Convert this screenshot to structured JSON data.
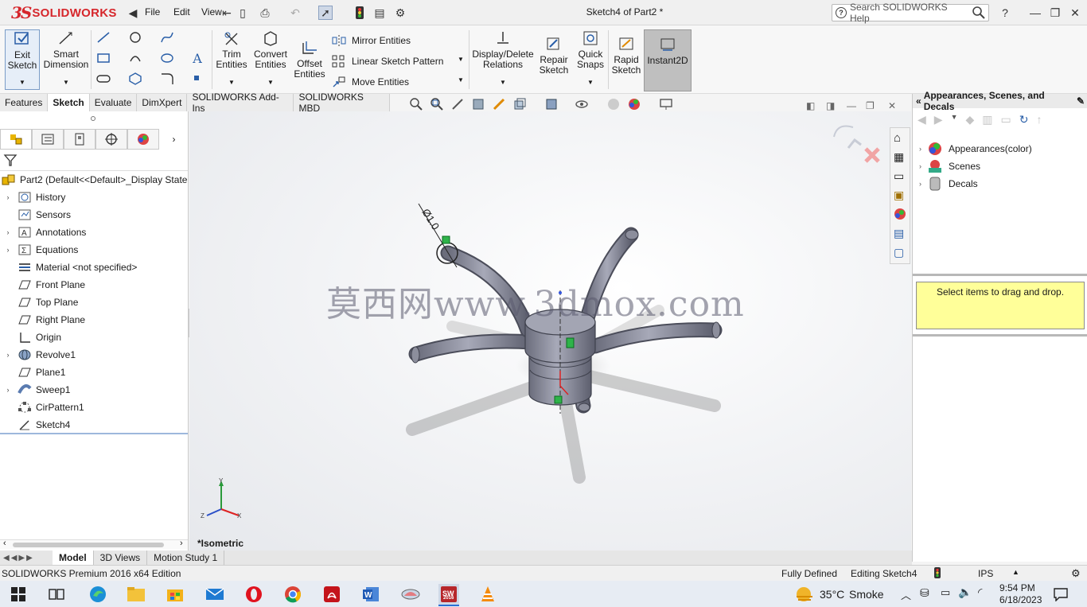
{
  "app": {
    "logo_text": "SOLIDWORKS",
    "document_title": "Sketch4 of Part2 *",
    "menu": [
      "File",
      "Edit",
      "View"
    ],
    "search_placeholder": "Search SOLIDWORKS Help"
  },
  "command_manager": {
    "exit_sketch": "Exit\nSketch",
    "smart_dimension": "Smart\nDimension",
    "trim_entities": "Trim\nEntities",
    "convert_entities": "Convert\nEntities",
    "offset_entities": "Offset\nEntities",
    "mirror_entities": "Mirror Entities",
    "linear_sketch_pattern": "Linear Sketch Pattern",
    "move_entities": "Move Entities",
    "display_delete_relations": "Display/Delete\nRelations",
    "repair_sketch": "Repair\nSketch",
    "quick_snaps": "Quick\nSnaps",
    "rapid_sketch": "Rapid\nSketch",
    "instant2d": "Instant2D"
  },
  "tabs": [
    "Features",
    "Sketch",
    "Evaluate",
    "DimXpert",
    "SOLIDWORKS Add-Ins",
    "SOLIDWORKS MBD"
  ],
  "active_tab": "Sketch",
  "feature_tree": {
    "root": "Part2  (Default<<Default>_Display State",
    "items": [
      {
        "label": "History",
        "expandable": true,
        "icon": "history-icon"
      },
      {
        "label": "Sensors",
        "expandable": false,
        "icon": "sensors-icon"
      },
      {
        "label": "Annotations",
        "expandable": true,
        "icon": "annotations-icon"
      },
      {
        "label": "Equations",
        "expandable": true,
        "icon": "equations-icon"
      },
      {
        "label": "Material <not specified>",
        "expandable": false,
        "icon": "material-icon"
      },
      {
        "label": "Front Plane",
        "expandable": false,
        "icon": "plane-icon"
      },
      {
        "label": "Top Plane",
        "expandable": false,
        "icon": "plane-icon"
      },
      {
        "label": "Right Plane",
        "expandable": false,
        "icon": "plane-icon"
      },
      {
        "label": "Origin",
        "expandable": false,
        "icon": "origin-icon"
      },
      {
        "label": "Revolve1",
        "expandable": true,
        "icon": "revolve-icon"
      },
      {
        "label": "Plane1",
        "expandable": false,
        "icon": "plane-icon"
      },
      {
        "label": "Sweep1",
        "expandable": true,
        "icon": "sweep-icon"
      },
      {
        "label": "CirPattern1",
        "expandable": false,
        "icon": "circular-pattern-icon"
      },
      {
        "label": "Sketch4",
        "expandable": false,
        "icon": "sketch-icon"
      }
    ]
  },
  "viewport": {
    "view_name": "*Isometric",
    "dimension_text": "Ø1.0",
    "watermark": "莫西网www.3dmox.com",
    "triad": {
      "x": "X",
      "y": "Y",
      "z": "Z"
    }
  },
  "task_pane": {
    "title": "Appearances, Scenes, and Decals",
    "items": [
      "Appearances(color)",
      "Scenes",
      "Decals"
    ],
    "drop_hint": "Select items to drag and drop."
  },
  "bottom_tabs": [
    "Model",
    "3D Views",
    "Motion Study 1"
  ],
  "status_bar": {
    "edition": "SOLIDWORKS Premium 2016 x64 Edition",
    "state": "Fully Defined",
    "editing": "Editing Sketch4",
    "units": "IPS"
  },
  "taskbar": {
    "weather_temp": "35°C",
    "weather_desc": "Smoke",
    "time": "9:54 PM",
    "date": "6/18/2023",
    "sw_badge": "2016"
  },
  "colors": {
    "brand_red": "#d6262b",
    "instant2d_active": "#bfbfbf",
    "drop_hint_bg": "#ffff99"
  }
}
